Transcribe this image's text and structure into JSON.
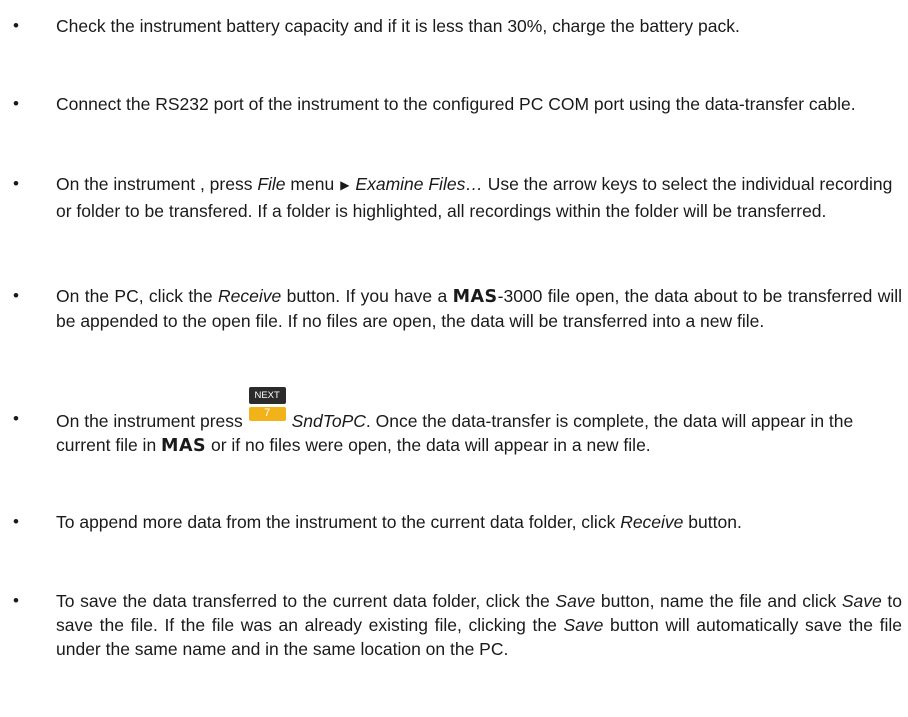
{
  "bullets": [
    {
      "text": "Check the instrument battery capacity and if it is less than 30%, charge the battery pack."
    },
    {
      "text": "Connect the RS232 port of the instrument to the configured PC COM port using the data-transfer cable."
    },
    {
      "p1": "On the instrument , press ",
      "file_menu": "File",
      "p2": " menu",
      "arrow": "▶",
      "examine": "Examine Files…",
      "p3": " Use the arrow keys to select the individual recording or folder to be transfered. If a folder is highlighted, all recordings within the folder will be transferred."
    },
    {
      "p1": "On the PC, click the ",
      "receive": "Receive",
      "p2": " button. If you have a ",
      "mas": "MAS",
      "p3": "-3000 file open, the data about to be transferred will be appended to the open file. If no files are open, the data will be transferred into a new file."
    },
    {
      "p1": "On the instrument press ",
      "key_top": "NEXT",
      "key_num": "7",
      "sndtopc": "SndToPC",
      "p2": ". Once the data-transfer is complete, the data will appear in the current file in ",
      "mas": "MAS",
      "p3": " or if no files were open, the data will appear in a new file."
    },
    {
      "p1": "To append more data from the instrument to the current data folder, click ",
      "receive": "Receive",
      "p2": " button."
    },
    {
      "p1": "To save the data transferred to the current data folder, click the ",
      "save1": "Save",
      "p2": " button, name the file and click ",
      "save2": "Save",
      "p3": " to save the file. If the file was an already existing file, clicking the ",
      "save3": "Save",
      "p4": " button will automatically save the file under the same name and in the same location on the PC."
    }
  ],
  "bullet_char": "•",
  "colors": {
    "text": "#1a1a1a",
    "key_face": "#f2b21a",
    "key_top": "#2b2b2b"
  }
}
